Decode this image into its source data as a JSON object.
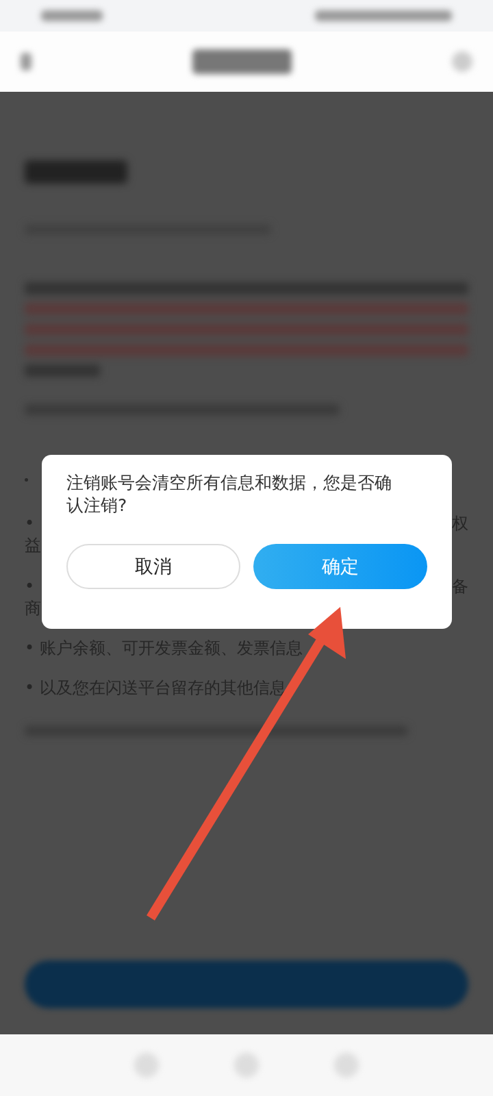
{
  "partial_items": [
    {
      "left": [
        "•",
        "益"
      ],
      "right": [
        "权"
      ]
    },
    {
      "left": [
        "•",
        "商"
      ],
      "right": [
        "备"
      ]
    }
  ],
  "items": [
    "• 账户余额、可开发票金额、发票信息",
    "• 以及您在闪送平台留存的其他信息"
  ],
  "dialog": {
    "message": "注销账号会清空所有信息和数据，您是否确认注销?",
    "buttons": [
      {
        "label": "取消",
        "kind": "secondary"
      },
      {
        "label": "确定",
        "kind": "primary"
      }
    ]
  }
}
